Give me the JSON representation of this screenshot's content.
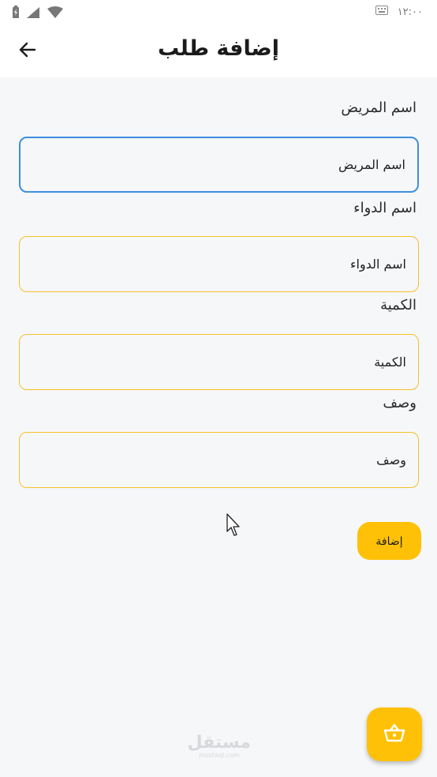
{
  "status_bar": {
    "time": "١٢:٠٠"
  },
  "header": {
    "title": "إضافة طلب"
  },
  "form": {
    "fields": [
      {
        "label": "اسم المريض",
        "value": "اسم المريض"
      },
      {
        "label": "اسم الدواء",
        "value": "اسم الدواء"
      },
      {
        "label": "الكمية",
        "value": "الكمية"
      },
      {
        "label": "وصف",
        "value": "وصف"
      }
    ],
    "submit_label": "إضافة"
  },
  "watermark": {
    "main": "مستقل",
    "sub": "mostaql.com"
  },
  "icons": {
    "back": "arrow-left-icon",
    "fab": "basket-icon",
    "battery": "battery-icon",
    "signal": "signal-icon",
    "wifi": "wifi-icon",
    "keyboard": "keyboard-icon"
  },
  "colors": {
    "accent": "#ffc107",
    "focused_border": "#3d8fe0",
    "field_border": "#f5c02a"
  }
}
